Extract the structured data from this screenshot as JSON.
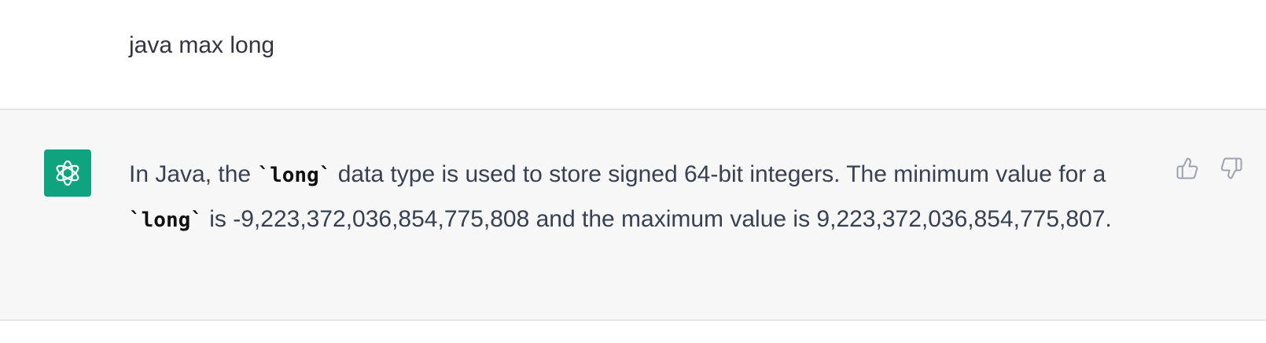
{
  "user_message": {
    "text": "java max long"
  },
  "assistant_message": {
    "part1": "In Java, the ",
    "code1": "`long`",
    "part2": " data type is used to store signed 64-bit integers. The minimum value for a ",
    "code2": "`long`",
    "part3": " is -9,223,372,036,854,775,808 and the maximum value is 9,223,372,036,854,775,807."
  },
  "icons": {
    "avatar": "openai-logo-icon",
    "thumbs_up": "thumbs-up-icon",
    "thumbs_down": "thumbs-down-icon"
  },
  "colors": {
    "avatar_bg": "#10a37f",
    "assistant_bg": "#f7f7f8",
    "divider": "#e5e5e6",
    "text": "#374151"
  }
}
